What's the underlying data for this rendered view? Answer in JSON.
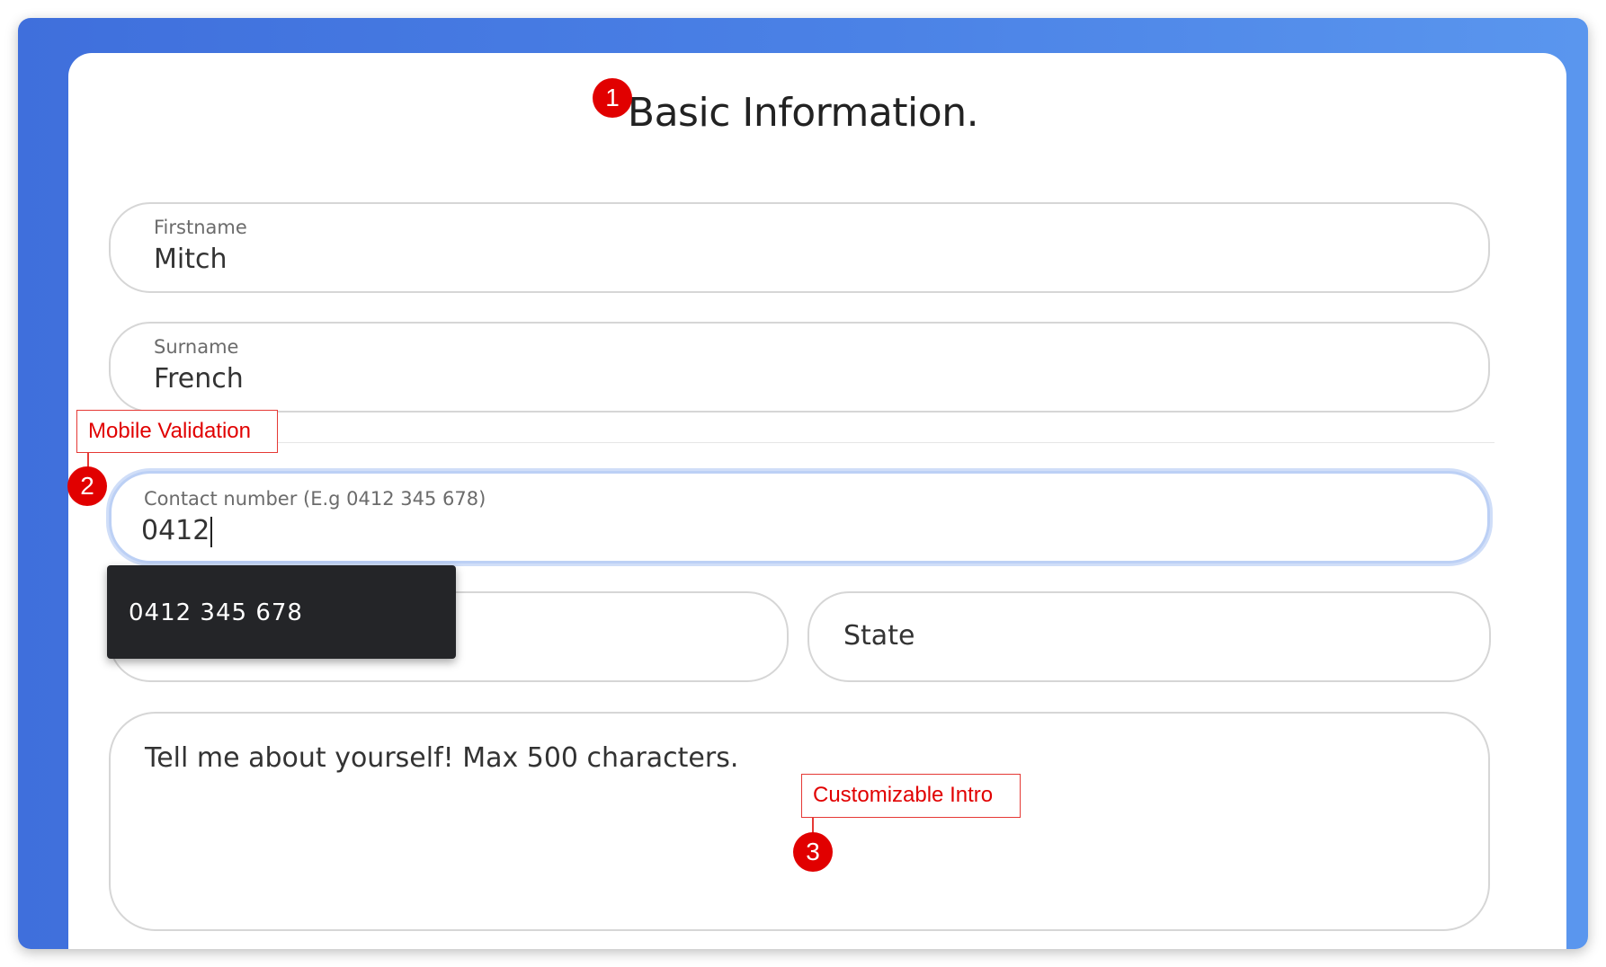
{
  "form": {
    "title": "Basic Information.",
    "firstname": {
      "label": "Firstname",
      "value": "Mitch"
    },
    "surname": {
      "label": "Surname",
      "value": "French"
    },
    "contact": {
      "label": "Contact number (E.g 0412 345 678)",
      "value": "0412"
    },
    "suggestion": "0412 345 678",
    "state": {
      "placeholder": "State"
    },
    "intro": {
      "placeholder": "Tell me about yourself! Max 500 characters."
    }
  },
  "annotations": [
    {
      "number": "1"
    },
    {
      "number": "2",
      "label": "Mobile Validation"
    },
    {
      "number": "3",
      "label": "Customizable Intro"
    }
  ],
  "colors": {
    "frame_gradient_start": "#3f6fdc",
    "frame_gradient_end": "#5a96ee",
    "annotation": "#e10000",
    "suggestion_bg": "#242528",
    "focus_ring": "#bcd0f5"
  }
}
